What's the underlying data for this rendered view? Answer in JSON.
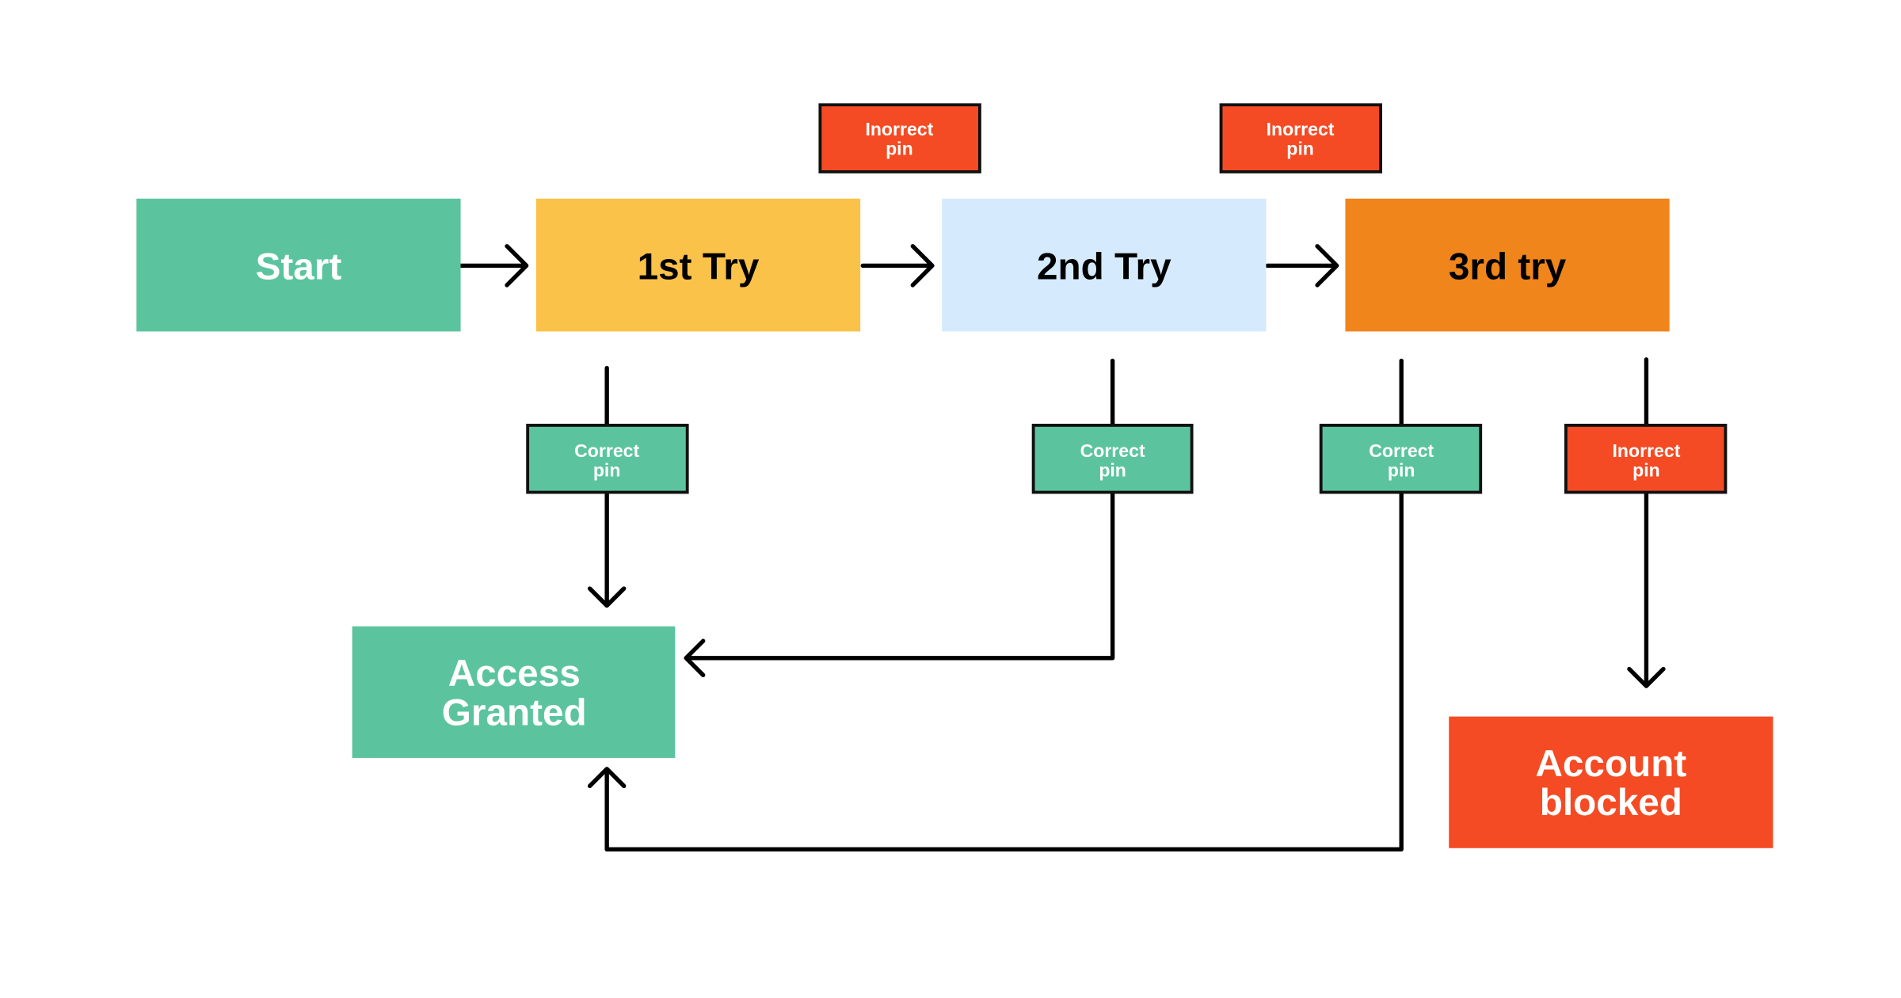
{
  "colors": {
    "green": "#5BC49F",
    "yellow": "#FBC24A",
    "light_blue": "#D5EAFD",
    "orange": "#EF851B",
    "red": "#F44B24",
    "line": "#000000"
  },
  "nodes": {
    "start": "Start",
    "try1": "1st Try",
    "try2": "2nd Try",
    "try3": "3rd try",
    "access_granted": [
      "Access",
      "Granted"
    ],
    "account_blocked": [
      "Account",
      "blocked"
    ]
  },
  "edge_labels": {
    "try1_to_try2": [
      "Inorrect",
      "pin"
    ],
    "try2_to_try3": [
      "Inorrect",
      "pin"
    ],
    "try1_correct": [
      "Correct",
      "pin"
    ],
    "try2_correct": [
      "Correct",
      "pin"
    ],
    "try3_correct": [
      "Correct",
      "pin"
    ],
    "try3_incorrect": [
      "Inorrect",
      "pin"
    ]
  }
}
